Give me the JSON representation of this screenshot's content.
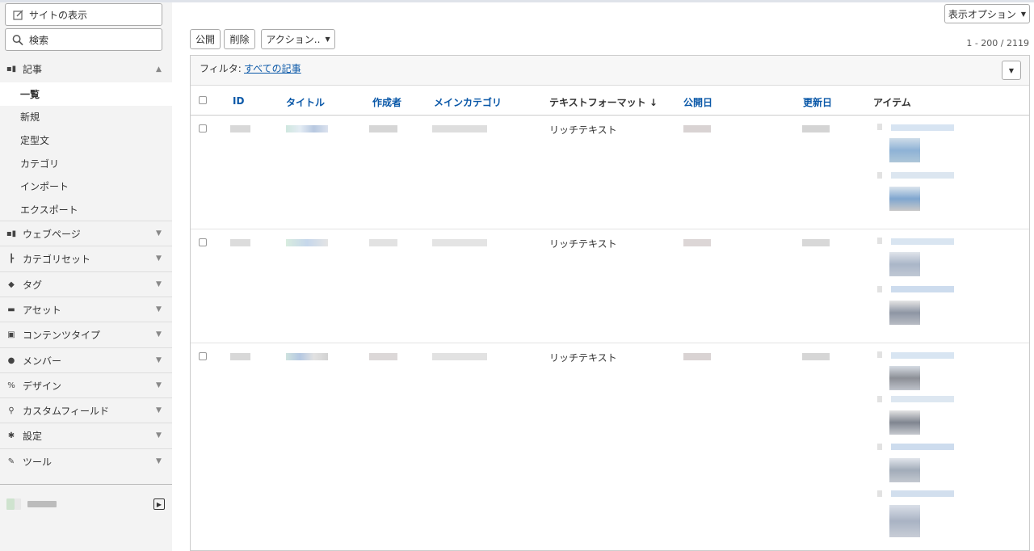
{
  "sidebar": {
    "view_site": "サイトの表示",
    "search": "検索",
    "sections": [
      {
        "label": "記事",
        "icon": "articles-icon",
        "expanded": true
      },
      {
        "label": "ウェブページ",
        "icon": "webpages-icon"
      },
      {
        "label": "カテゴリセット",
        "icon": "category-set-icon"
      },
      {
        "label": "タグ",
        "icon": "tag-icon"
      },
      {
        "label": "アセット",
        "icon": "asset-icon"
      },
      {
        "label": "コンテンツタイプ",
        "icon": "content-type-icon"
      },
      {
        "label": "メンバー",
        "icon": "member-icon"
      },
      {
        "label": "デザイン",
        "icon": "design-icon"
      },
      {
        "label": "カスタムフィールド",
        "icon": "custom-field-icon"
      },
      {
        "label": "設定",
        "icon": "gear-icon"
      },
      {
        "label": "ツール",
        "icon": "wrench-icon"
      }
    ],
    "sub_items": [
      "一覧",
      "新規",
      "定型文",
      "カテゴリ",
      "インポート",
      "エクスポート"
    ]
  },
  "toolbar": {
    "display_options": "表示オプション",
    "publish": "公開",
    "delete": "削除",
    "actions": "アクション..",
    "count": "1 - 200 / 2119"
  },
  "filter": {
    "label": "フィルタ:",
    "value": "すべての記事"
  },
  "table": {
    "columns": [
      "ID",
      "タイトル",
      "作成者",
      "メインカテゴリ",
      "テキストフォーマット ↓",
      "公開日",
      "更新日",
      "アイテム"
    ],
    "rows": [
      {
        "text_format": "リッチテキスト"
      },
      {
        "text_format": "リッチテキスト"
      },
      {
        "text_format": "リッチテキスト"
      }
    ]
  }
}
